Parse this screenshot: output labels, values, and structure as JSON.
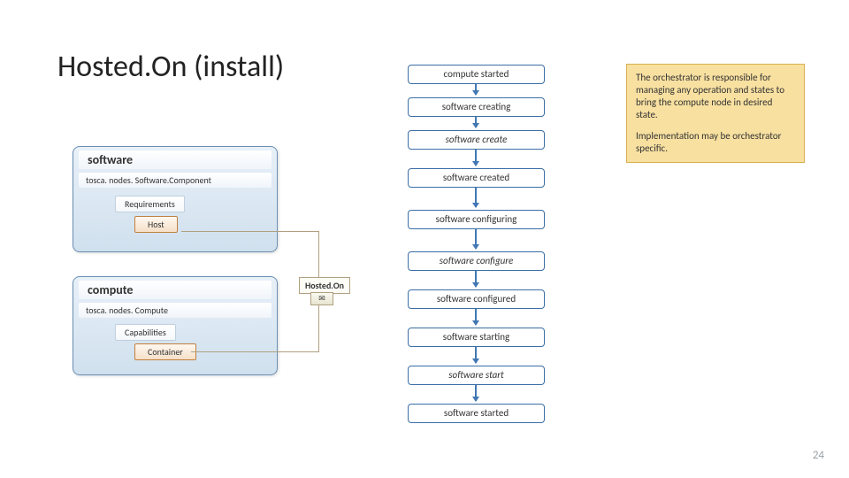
{
  "title": "Hosted.On (install)",
  "software_node": {
    "header": "software",
    "type": "tosca. nodes. Software.Component",
    "req_label": "Requirements",
    "host_label": "Host"
  },
  "compute_node": {
    "header": "compute",
    "type": "tosca. nodes. Compute",
    "cap_label": "Capabilities",
    "container_label": "Container"
  },
  "hostedon_label": "Hosted.On",
  "flow": {
    "s0": "compute started",
    "s1": "software creating",
    "s2": "software create",
    "s3": "software created",
    "s4": "software configuring",
    "s5": "software configure",
    "s6": "software configured",
    "s7": "software starting",
    "s8": "software start",
    "s9": "software started"
  },
  "note": {
    "p1": "The orchestrator is responsible for managing any operation and states to bring the compute node in desired state.",
    "p2": "Implementation may be orchestrator specific."
  },
  "pagenum": "24",
  "hostedon_glyph": "✉"
}
